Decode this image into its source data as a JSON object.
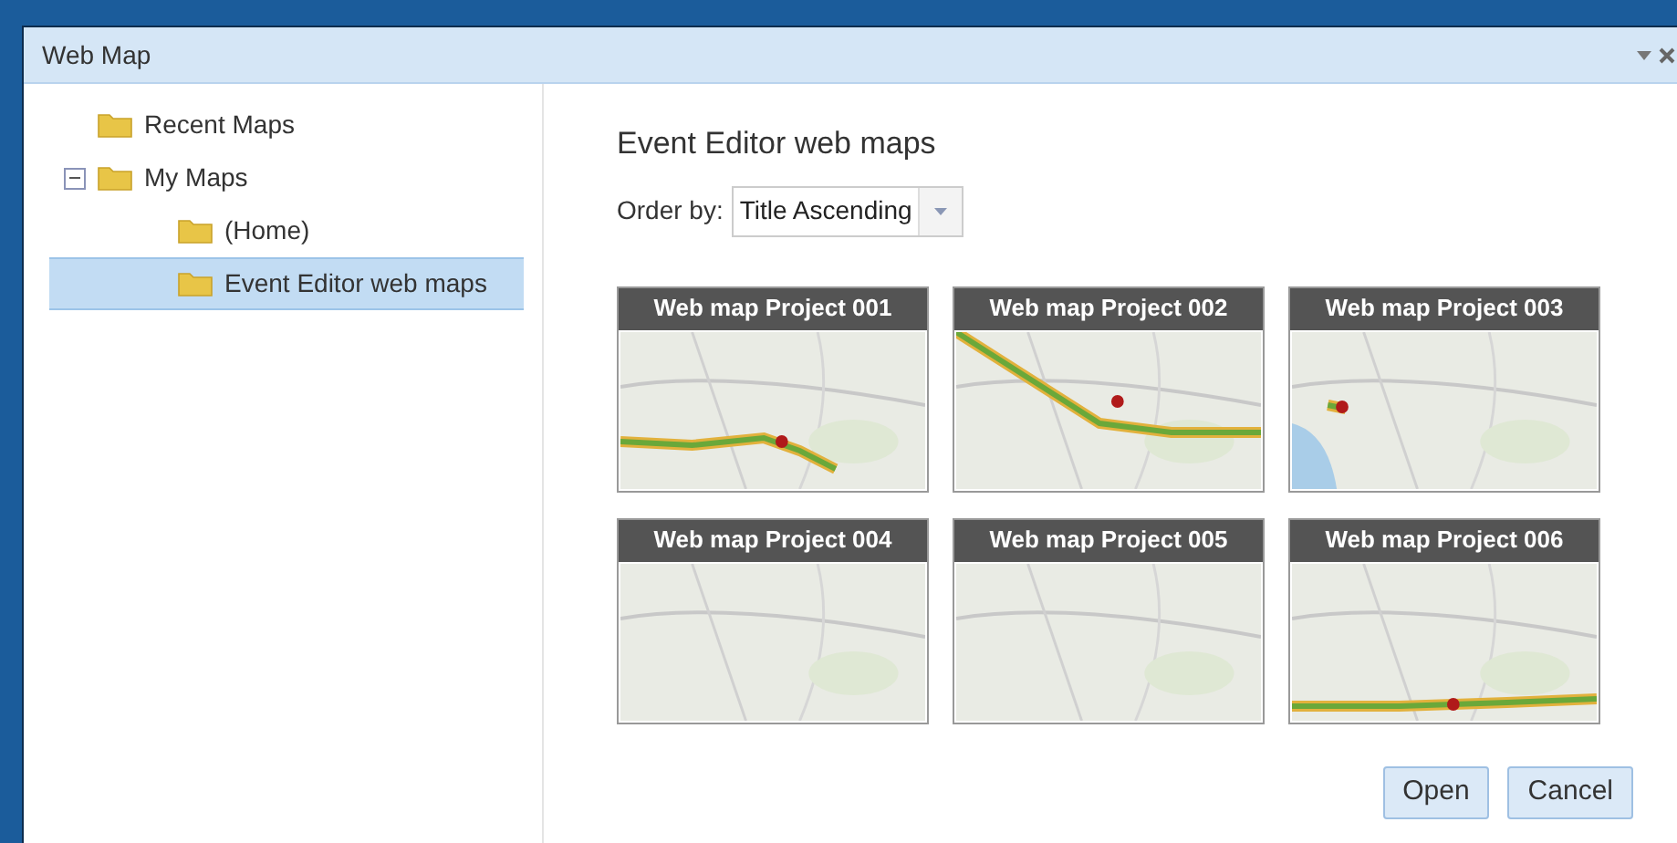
{
  "window": {
    "title": "Web Map"
  },
  "tree": [
    {
      "label": "Recent Maps",
      "selected": false
    },
    {
      "label": "My Maps",
      "selected": false,
      "expanded": true,
      "children": [
        {
          "label": "(Home)",
          "selected": false
        },
        {
          "label": "Event Editor web maps",
          "selected": true
        }
      ]
    }
  ],
  "content": {
    "heading": "Event Editor web maps",
    "order_label": "Order by:",
    "order_value": "Title Ascending"
  },
  "maps": [
    {
      "title": "Web map Project 001"
    },
    {
      "title": "Web map Project 002"
    },
    {
      "title": "Web map Project 003"
    },
    {
      "title": "Web map Project 004"
    },
    {
      "title": "Web map Project 005"
    },
    {
      "title": "Web map Project 006"
    }
  ],
  "buttons": [
    "Open",
    "Cancel"
  ]
}
